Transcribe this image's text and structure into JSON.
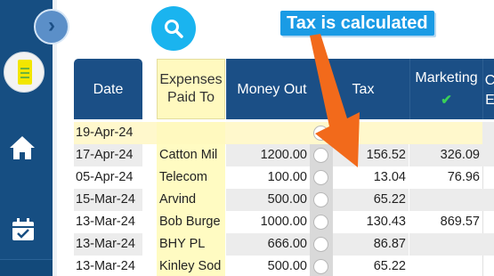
{
  "search": {
    "icon": "search-icon"
  },
  "annotation": {
    "text": "Tax is calculated",
    "color": "#1a9be5",
    "arrow_color": "#f26a1b"
  },
  "sidebar": {
    "collapse_icon": "chevron-right-icon",
    "items": [
      {
        "icon": "app-logo"
      },
      {
        "icon": "home-icon"
      },
      {
        "icon": "calendar-check-icon"
      }
    ]
  },
  "table": {
    "headers": {
      "date": "Date",
      "expenses_paid_to": "Expenses Paid To",
      "money_out": "Money Out",
      "tax": "Tax",
      "marketing": "Marketing",
      "more": "C\nE"
    },
    "rows": [
      {
        "date": "19-Apr-24",
        "paid_to": "",
        "money_out": "",
        "tax": "",
        "marketing": ""
      },
      {
        "date": "17-Apr-24",
        "paid_to": "Catton Mil",
        "money_out": "1200.00",
        "tax": "156.52",
        "marketing": "326.09"
      },
      {
        "date": "05-Apr-24",
        "paid_to": "Telecom",
        "money_out": "100.00",
        "tax": "13.04",
        "marketing": "76.96"
      },
      {
        "date": "15-Mar-24",
        "paid_to": "Arvind",
        "money_out": "500.00",
        "tax": "65.22",
        "marketing": ""
      },
      {
        "date": "13-Mar-24",
        "paid_to": "Bob Burge",
        "money_out": "1000.00",
        "tax": "130.43",
        "marketing": "869.57"
      },
      {
        "date": "13-Mar-24",
        "paid_to": "BHY PL",
        "money_out": "666.00",
        "tax": "86.87",
        "marketing": ""
      },
      {
        "date": "13-Mar-24",
        "paid_to": "Kinley Sod",
        "money_out": "500.00",
        "tax": "65.22",
        "marketing": ""
      }
    ]
  },
  "colors": {
    "sidebar": "#164e82",
    "header": "#1b4f86",
    "highlight": "#fff9bf",
    "search": "#1ab4ef",
    "check": "#3ad058"
  }
}
